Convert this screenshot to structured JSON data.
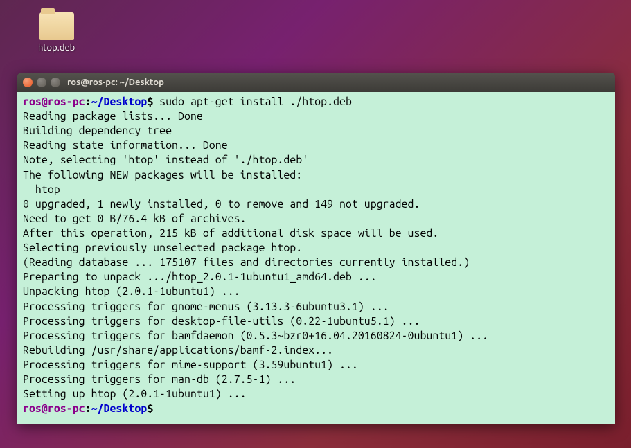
{
  "desktop": {
    "file_label": "htop.deb"
  },
  "terminal": {
    "title": "ros@ros-pc: ~/Desktop",
    "prompt": {
      "user": "ros",
      "at": "@",
      "host": "ros-pc",
      "colon": ":",
      "path": "~/Desktop",
      "symbol": "$"
    },
    "command": " sudo apt-get install ./htop.deb",
    "output_lines": [
      "Reading package lists... Done",
      "Building dependency tree",
      "Reading state information... Done",
      "Note, selecting 'htop' instead of './htop.deb'",
      "The following NEW packages will be installed:",
      "  htop",
      "0 upgraded, 1 newly installed, 0 to remove and 149 not upgraded.",
      "Need to get 0 B/76.4 kB of archives.",
      "After this operation, 215 kB of additional disk space will be used.",
      "Selecting previously unselected package htop.",
      "(Reading database ... 175107 files and directories currently installed.)",
      "Preparing to unpack .../htop_2.0.1-1ubuntu1_amd64.deb ...",
      "Unpacking htop (2.0.1-1ubuntu1) ...",
      "Processing triggers for gnome-menus (3.13.3-6ubuntu3.1) ...",
      "Processing triggers for desktop-file-utils (0.22-1ubuntu5.1) ...",
      "Processing triggers for bamfdaemon (0.5.3~bzr0+16.04.20160824-0ubuntu1) ...",
      "Rebuilding /usr/share/applications/bamf-2.index...",
      "Processing triggers for mime-support (3.59ubuntu1) ...",
      "Processing triggers for man-db (2.7.5-1) ...",
      "Setting up htop (2.0.1-1ubuntu1) ..."
    ]
  },
  "colors": {
    "prompt_user": "#8b008b",
    "prompt_path": "#0000cd",
    "terminal_bg": "#c5f0d8"
  }
}
